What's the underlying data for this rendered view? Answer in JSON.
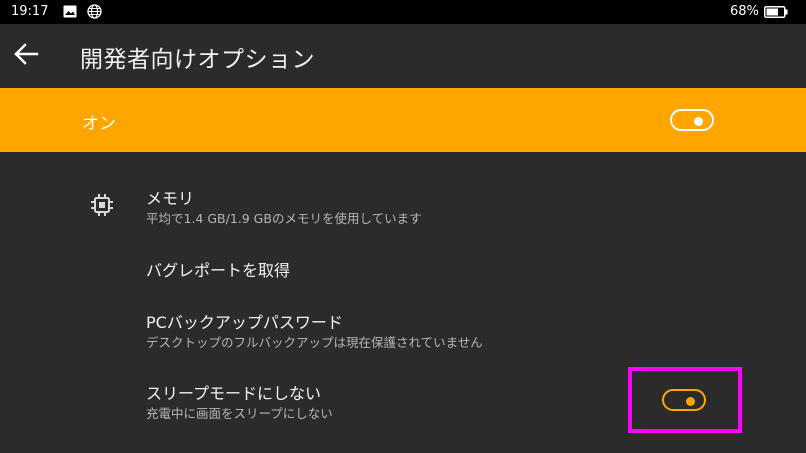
{
  "status_bar": {
    "time": "19:17",
    "battery_percent": "68%",
    "icons": [
      "image-icon",
      "globe-icon",
      "battery-icon"
    ]
  },
  "app_bar": {
    "title": "開発者向けオプション",
    "back_icon": "arrow-left-icon"
  },
  "master_switch": {
    "label": "オン",
    "state": "on"
  },
  "items": [
    {
      "icon": "memory-chip-icon",
      "title": "メモリ",
      "subtitle": "平均で1.4 GB/1.9 GBのメモリを使用しています"
    },
    {
      "title": "バグレポートを取得"
    },
    {
      "title": "PCバックアップパスワード",
      "subtitle": "デスクトップのフルバックアップは現在保護されていません"
    },
    {
      "title": "スリープモードにしない",
      "subtitle": "充電中に画面をスリープにしない",
      "toggle_state": "on"
    }
  ],
  "colors": {
    "accent": "#ffa500",
    "background": "#2b2b2b",
    "status_bar": "#000000",
    "highlight": "#ff00ff"
  }
}
